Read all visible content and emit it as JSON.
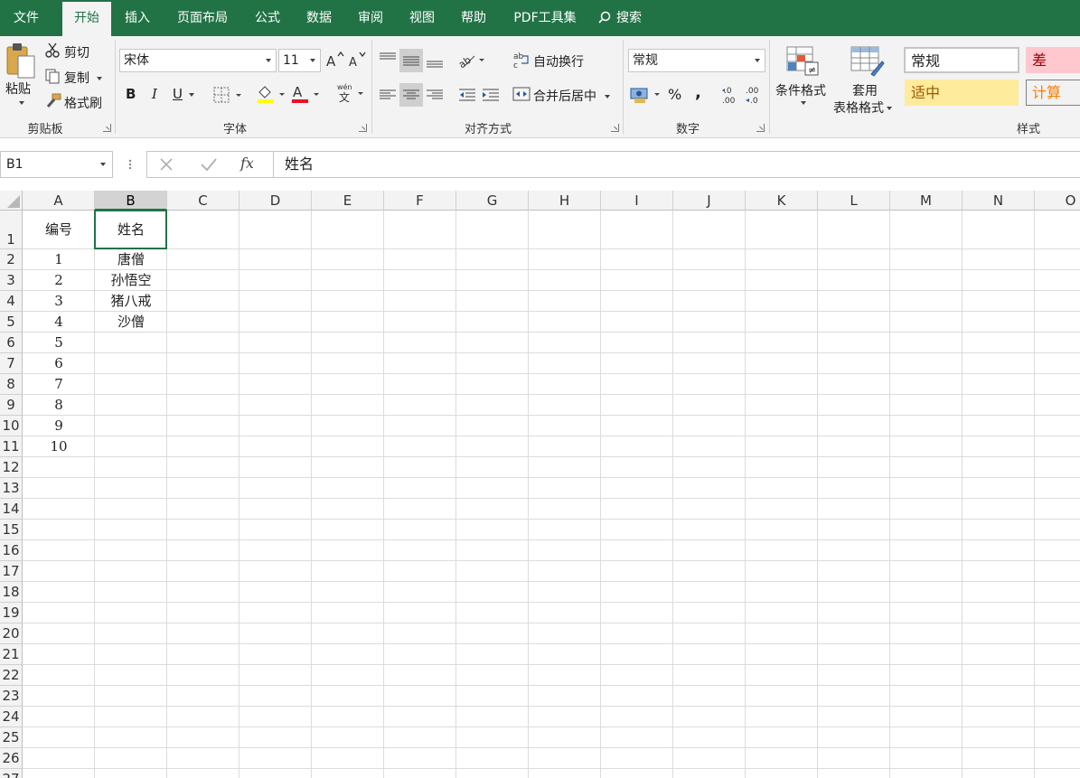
{
  "menu": {
    "tabs": [
      "文件",
      "开始",
      "插入",
      "页面布局",
      "公式",
      "数据",
      "审阅",
      "视图",
      "帮助",
      "PDF工具集"
    ],
    "active": "开始",
    "search_label": "搜索"
  },
  "ribbon": {
    "clipboard": {
      "paste": "粘贴",
      "cut": "剪切",
      "copy": "复制",
      "format_painter": "格式刷",
      "label": "剪贴板"
    },
    "font": {
      "name": "宋体",
      "size": "11",
      "bold": "B",
      "italic": "I",
      "underline": "U",
      "label": "字体"
    },
    "alignment": {
      "wrap": "自动换行",
      "merge": "合并后居中",
      "label": "对齐方式"
    },
    "number": {
      "format": "常规",
      "percent": "%",
      "comma": ",",
      "label": "数字"
    },
    "styles": {
      "conditional": "条件格式",
      "table_line1": "套用",
      "table_line2": "表格格式",
      "normal": "常规",
      "bad": "差",
      "neutral": "适中",
      "calc": "计算",
      "label": "样式"
    }
  },
  "formula_bar": {
    "name_box": "B1",
    "fx": "fx",
    "content": "姓名"
  },
  "grid": {
    "columns": [
      "A",
      "B",
      "C",
      "D",
      "E",
      "F",
      "G",
      "H",
      "I",
      "J",
      "K",
      "L",
      "M",
      "N",
      "O"
    ],
    "selected_column": "B",
    "rows": [
      "1",
      "2",
      "3",
      "4",
      "5",
      "6",
      "7",
      "8",
      "9",
      "10",
      "11",
      "12",
      "13",
      "14",
      "15",
      "16",
      "17",
      "18",
      "19",
      "20",
      "21",
      "22",
      "23",
      "24",
      "25",
      "26",
      "27"
    ],
    "cells": [
      [
        "编号",
        "姓名"
      ],
      [
        "1",
        "唐僧"
      ],
      [
        "2",
        "孙悟空"
      ],
      [
        "3",
        "猪八戒"
      ],
      [
        "4",
        "沙僧"
      ],
      [
        "5",
        ""
      ],
      [
        "6",
        ""
      ],
      [
        "7",
        ""
      ],
      [
        "8",
        ""
      ],
      [
        "9",
        ""
      ],
      [
        "10",
        ""
      ]
    ]
  },
  "colors": {
    "accent": "#217346",
    "bad_bg": "#ffc7ce",
    "bad_fg": "#9c0006",
    "neutral_bg": "#ffeb9c",
    "neutral_fg": "#9c5700",
    "calc_bg": "#f2f2f2",
    "calc_fg": "#fa7d00"
  }
}
